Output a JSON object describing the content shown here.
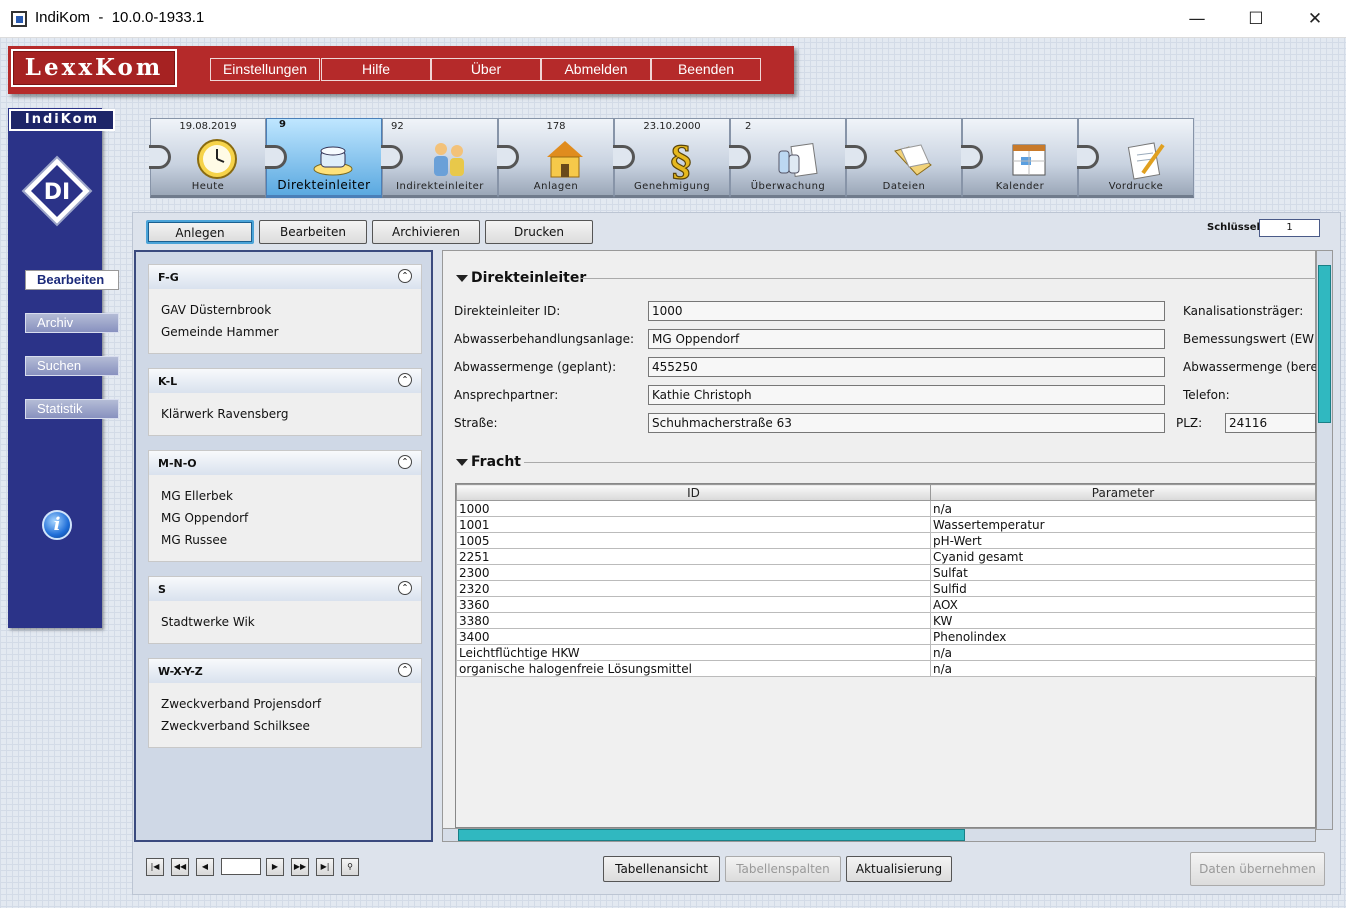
{
  "window": {
    "title": "IndiKom  -  10.0.0-1933.1",
    "minimize": "—",
    "maximize": "☐",
    "close": "✕"
  },
  "banner": {
    "logo": "LexxKom",
    "menu": [
      "Einstellungen",
      "Hilfe",
      "Über",
      "Abmelden",
      "Beenden"
    ]
  },
  "sidebar": {
    "brand": "IndiKom",
    "logo_text": "DI",
    "items": [
      {
        "label": "Bearbeiten",
        "active": true
      },
      {
        "label": "Archiv"
      },
      {
        "label": "Suchen"
      },
      {
        "label": "Statistik"
      }
    ],
    "info_icon": "i"
  },
  "tabs": [
    {
      "label": "Heute",
      "count": "19.08.2019",
      "icon": "clock-icon"
    },
    {
      "label": "Direkteinleiter",
      "count": "9",
      "icon": "direkteinleiter-icon",
      "selected": true
    },
    {
      "label": "Indirekteinleiter",
      "count": "92",
      "icon": "people-icon"
    },
    {
      "label": "Anlagen",
      "count": "178",
      "icon": "house-icon"
    },
    {
      "label": "Genehmigung",
      "count": "23.10.2000",
      "icon": "paragraph-icon"
    },
    {
      "label": "Überwachung",
      "count": "2",
      "icon": "lab-bottles-icon"
    },
    {
      "label": "Dateien",
      "count": "",
      "icon": "folder-icon"
    },
    {
      "label": "Kalender",
      "count": "",
      "icon": "calendar-icon"
    },
    {
      "label": "Vordrucke",
      "count": "",
      "icon": "form-pen-icon"
    }
  ],
  "toolbar": {
    "anlegen": "Anlegen",
    "bearbeiten": "Bearbeiten",
    "archivieren": "Archivieren",
    "drucken": "Drucken",
    "schluessel_label": "Schlüssel:",
    "schluessel_value": "1"
  },
  "list": [
    {
      "head": "F-G",
      "items": [
        "GAV Düsternbrook",
        "Gemeinde Hammer"
      ]
    },
    {
      "head": "K-L",
      "items": [
        "Klärwerk Ravensberg"
      ]
    },
    {
      "head": "M-N-O",
      "items": [
        "MG Ellerbek",
        "MG Oppendorf",
        "MG Russee"
      ]
    },
    {
      "head": "S",
      "items": [
        "Stadtwerke Wik"
      ]
    },
    {
      "head": "W-X-Y-Z",
      "items": [
        "Zweckverband Projensdorf",
        "Zweckverband Schilksee"
      ]
    }
  ],
  "detail": {
    "section1": "Direkteinleiter",
    "fields": [
      {
        "label": "Direkteinleiter ID:",
        "value": "1000",
        "right_label": "Kanalisationsträger:"
      },
      {
        "label": "Abwasserbehandlungsanlage:",
        "value": "MG Oppendorf",
        "right_label": "Bemessungswert (EW"
      },
      {
        "label": "Abwassermenge (geplant):",
        "value": "455250",
        "right_label": "Abwassermenge (berec"
      },
      {
        "label": "Ansprechpartner:",
        "value": "Kathie Christoph",
        "right_label": "Telefon:"
      },
      {
        "label": "Straße:",
        "value": "Schuhmacherstraße 63",
        "right_label": "PLZ:",
        "right_value": "24116"
      }
    ],
    "section2": "Fracht",
    "table": {
      "columns": [
        "ID",
        "Parameter"
      ],
      "rows": [
        [
          "1000",
          "n/a"
        ],
        [
          "1001",
          "Wassertemperatur"
        ],
        [
          "1005",
          "pH-Wert"
        ],
        [
          "2251",
          "Cyanid gesamt"
        ],
        [
          "2300",
          "Sulfat"
        ],
        [
          "2320",
          "Sulfid"
        ],
        [
          "3360",
          "AOX"
        ],
        [
          "3380",
          "KW"
        ],
        [
          "3400",
          "Phenolindex"
        ],
        [
          "Leichtflüchtige HKW",
          "n/a"
        ],
        [
          "organische halogenfreie Lösungsmittel",
          "n/a"
        ]
      ]
    }
  },
  "bottom": {
    "page_value": "",
    "tabellenansicht": "Tabellenansicht",
    "tabellenspalten": "Tabellenspalten",
    "aktualisierung": "Aktualisierung",
    "daten_uebernehmen": "Daten übernehmen"
  },
  "pager_icons": [
    "first-page-icon",
    "prev-block-icon",
    "prev-page-icon",
    "next-page-icon",
    "next-block-icon",
    "last-page-icon",
    "search-icon"
  ],
  "colors": {
    "banner": "#b52a2a",
    "sidebar": "#2b3388",
    "accent": "#30b8c0"
  }
}
